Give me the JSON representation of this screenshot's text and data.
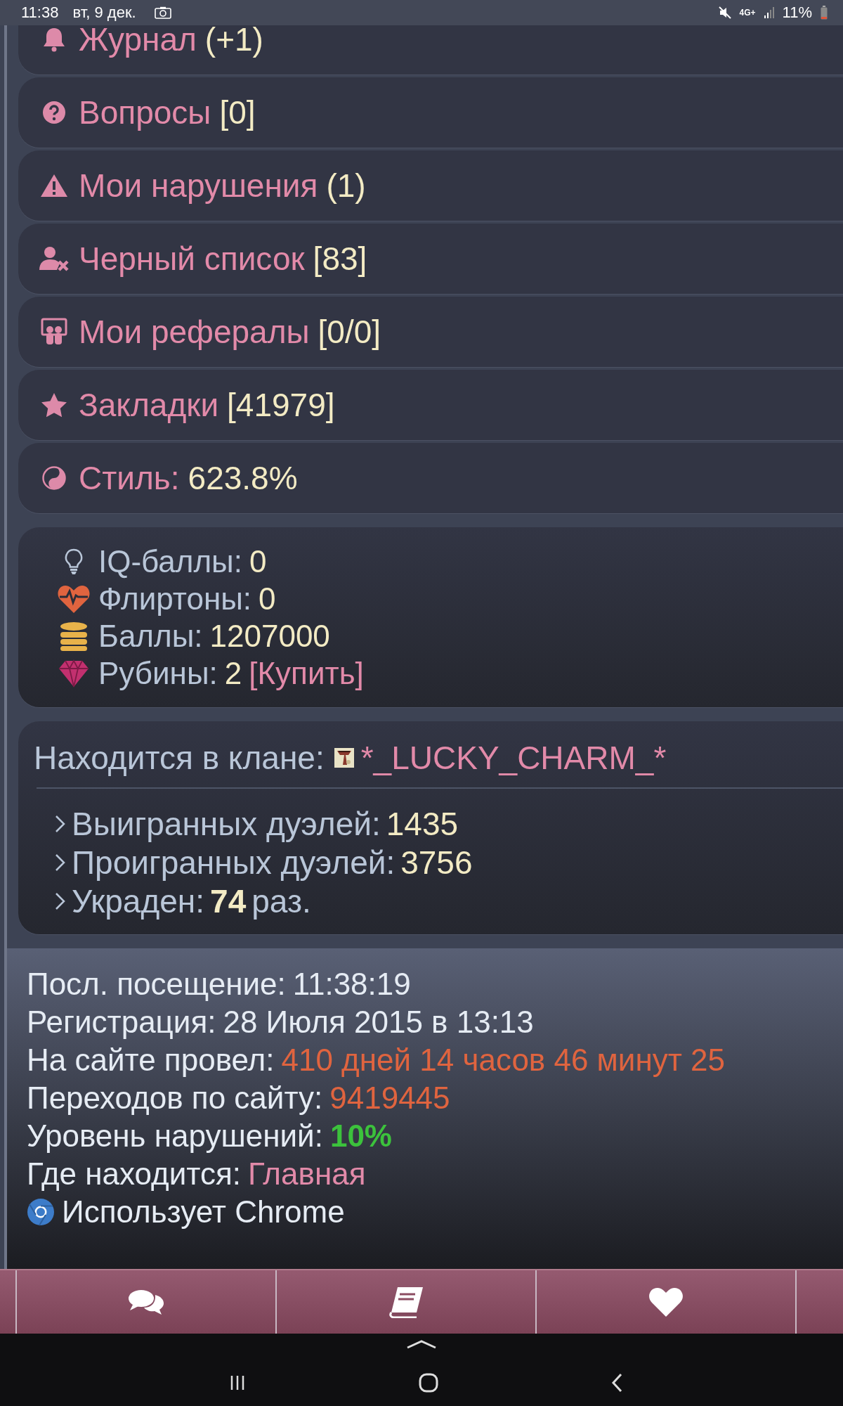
{
  "status_bar": {
    "time": "11:38",
    "date": "вт, 9 дек.",
    "network": "4G+",
    "battery": "11%"
  },
  "menu": [
    {
      "label": "Журнал",
      "count": "(+1)"
    },
    {
      "label": "Вопросы",
      "count": "[0]"
    },
    {
      "label": "Мои нарушения",
      "count": "(1)"
    },
    {
      "label": "Черный список",
      "count": "[83]"
    },
    {
      "label": "Мои рефералы",
      "count": "[0/0]"
    },
    {
      "label": "Закладки",
      "count": "[41979]"
    },
    {
      "label": "Стиль:",
      "count": "623.8%"
    }
  ],
  "currencies": [
    {
      "label": "IQ-баллы:",
      "value": "0"
    },
    {
      "label": "Флиртоны:",
      "value": "0"
    },
    {
      "label": "Баллы:",
      "value": "1207000"
    },
    {
      "label": "Рубины:",
      "value": "2",
      "link": "[Купить]"
    }
  ],
  "clan": {
    "label": "Находится в клане:",
    "name": "*_LUCKY_CHARM_*",
    "stats": [
      {
        "label": "Выигранных дуэлей:",
        "value": "1435",
        "emphasis": false
      },
      {
        "label": "Проигранных дуэлей:",
        "value": "3756",
        "emphasis": false
      },
      {
        "label": "Украден:",
        "value": "74",
        "suffix": "раз.",
        "emphasis": true
      }
    ]
  },
  "profile": [
    {
      "label": "Посл. посещение:",
      "value": "11:38:19"
    },
    {
      "label": "Регистрация:",
      "value": "28 Июля 2015 в 13:13"
    },
    {
      "label": "На сайте провел:",
      "value": "410 дней 14 часов 46 минут 25",
      "color": "#e0643f"
    },
    {
      "label": "Переходов по сайту:",
      "value": "9419445",
      "color": "#e0643f"
    },
    {
      "label": "Уровень нарушений:",
      "value": "10%",
      "color": "#3cc23c",
      "emphasis": true
    },
    {
      "label": "Где находится:",
      "value": "Главная",
      "color": "#e28aa9"
    }
  ],
  "browser": "Использует Chrome"
}
